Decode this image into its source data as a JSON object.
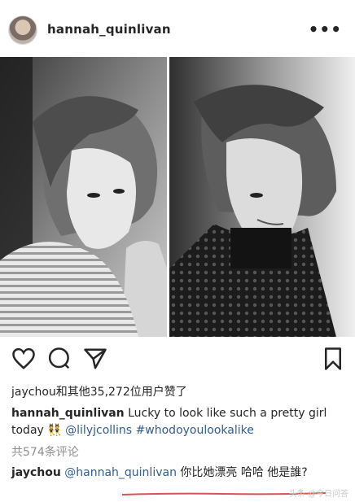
{
  "post": {
    "username": "hannah_quinlivan",
    "more_label": "•••",
    "likes_text": "jaychou和其他35,272位用户赞了",
    "caption": {
      "username": "hannah_quinlivan",
      "text_1": "Lucky to look like such a pretty girl today ",
      "emoji": "👯",
      "mention": "@lilyjcollins",
      "hashtag": "#whodoyoulookalike"
    },
    "comments_count": "共574条评论",
    "comment": {
      "username": "jaychou",
      "mention": "@hannah_quinlivan",
      "text": "你比她漂亮 哈哈 他是誰?"
    },
    "watermark": "头条 @今日问答"
  },
  "icons": [
    "heart-icon",
    "comment-icon",
    "share-icon",
    "bookmark-icon"
  ],
  "colors": {
    "link": "#2e5d93",
    "muted": "#8e8e8e",
    "underline": "#d9534f"
  }
}
